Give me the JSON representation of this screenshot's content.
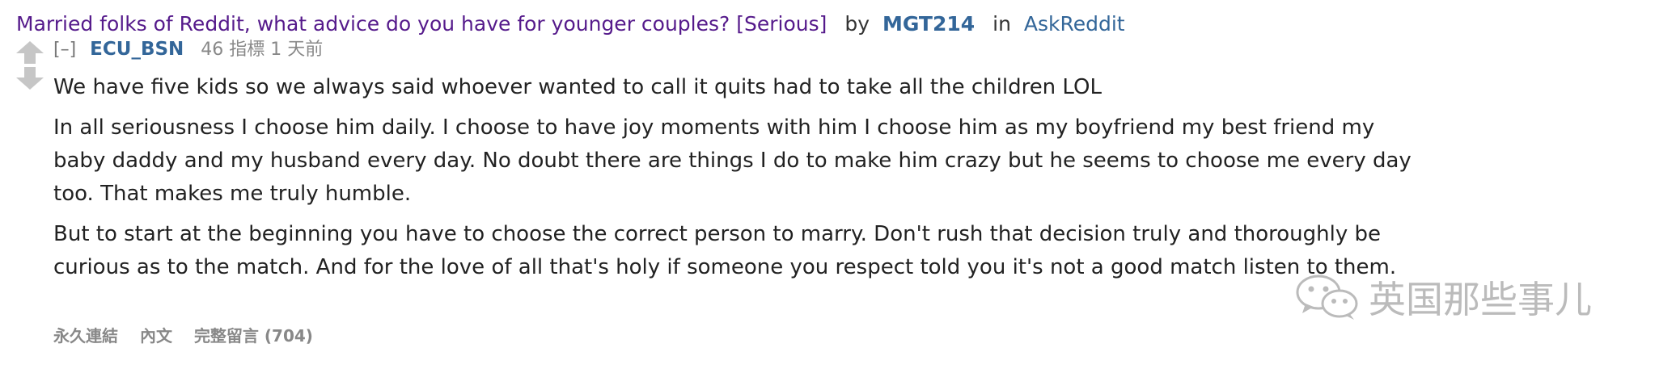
{
  "post": {
    "title": "Married folks of Reddit, what advice do you have for younger couples? [Serious]",
    "by_label": "by",
    "author": "MGT214",
    "in_label": "in",
    "subreddit": "AskReddit"
  },
  "comment": {
    "collapse_label": "[–]",
    "author": "ECU_BSN",
    "meta": "46 指標 1 天前",
    "paragraphs": [
      "We have five kids so we always said whoever wanted to call it quits had to take all the children LOL",
      "In all seriousness I choose him daily. I choose to have joy moments with him I choose him as my boyfriend my best friend my baby daddy and my husband every day. No doubt there are things I do to make him crazy but he seems to choose me every day too. That makes me truly humble.",
      "But to start at the beginning you have to choose the correct person to marry. Don't rush that decision truly and thoroughly be curious as to the match. And for the love of all that's holy if someone you respect told you it's not a good match listen to them."
    ],
    "actions": {
      "permalink": "永久連結",
      "context": "內文",
      "full_comments": "完整留言 (704)"
    }
  },
  "watermark": {
    "text": "英国那些事儿",
    "logo_icon": "wechat-icon"
  },
  "colors": {
    "link_visited": "#551a8b",
    "author_blue": "#336699",
    "meta_gray": "#888888",
    "arrow_gray": "#c6c6c6"
  }
}
